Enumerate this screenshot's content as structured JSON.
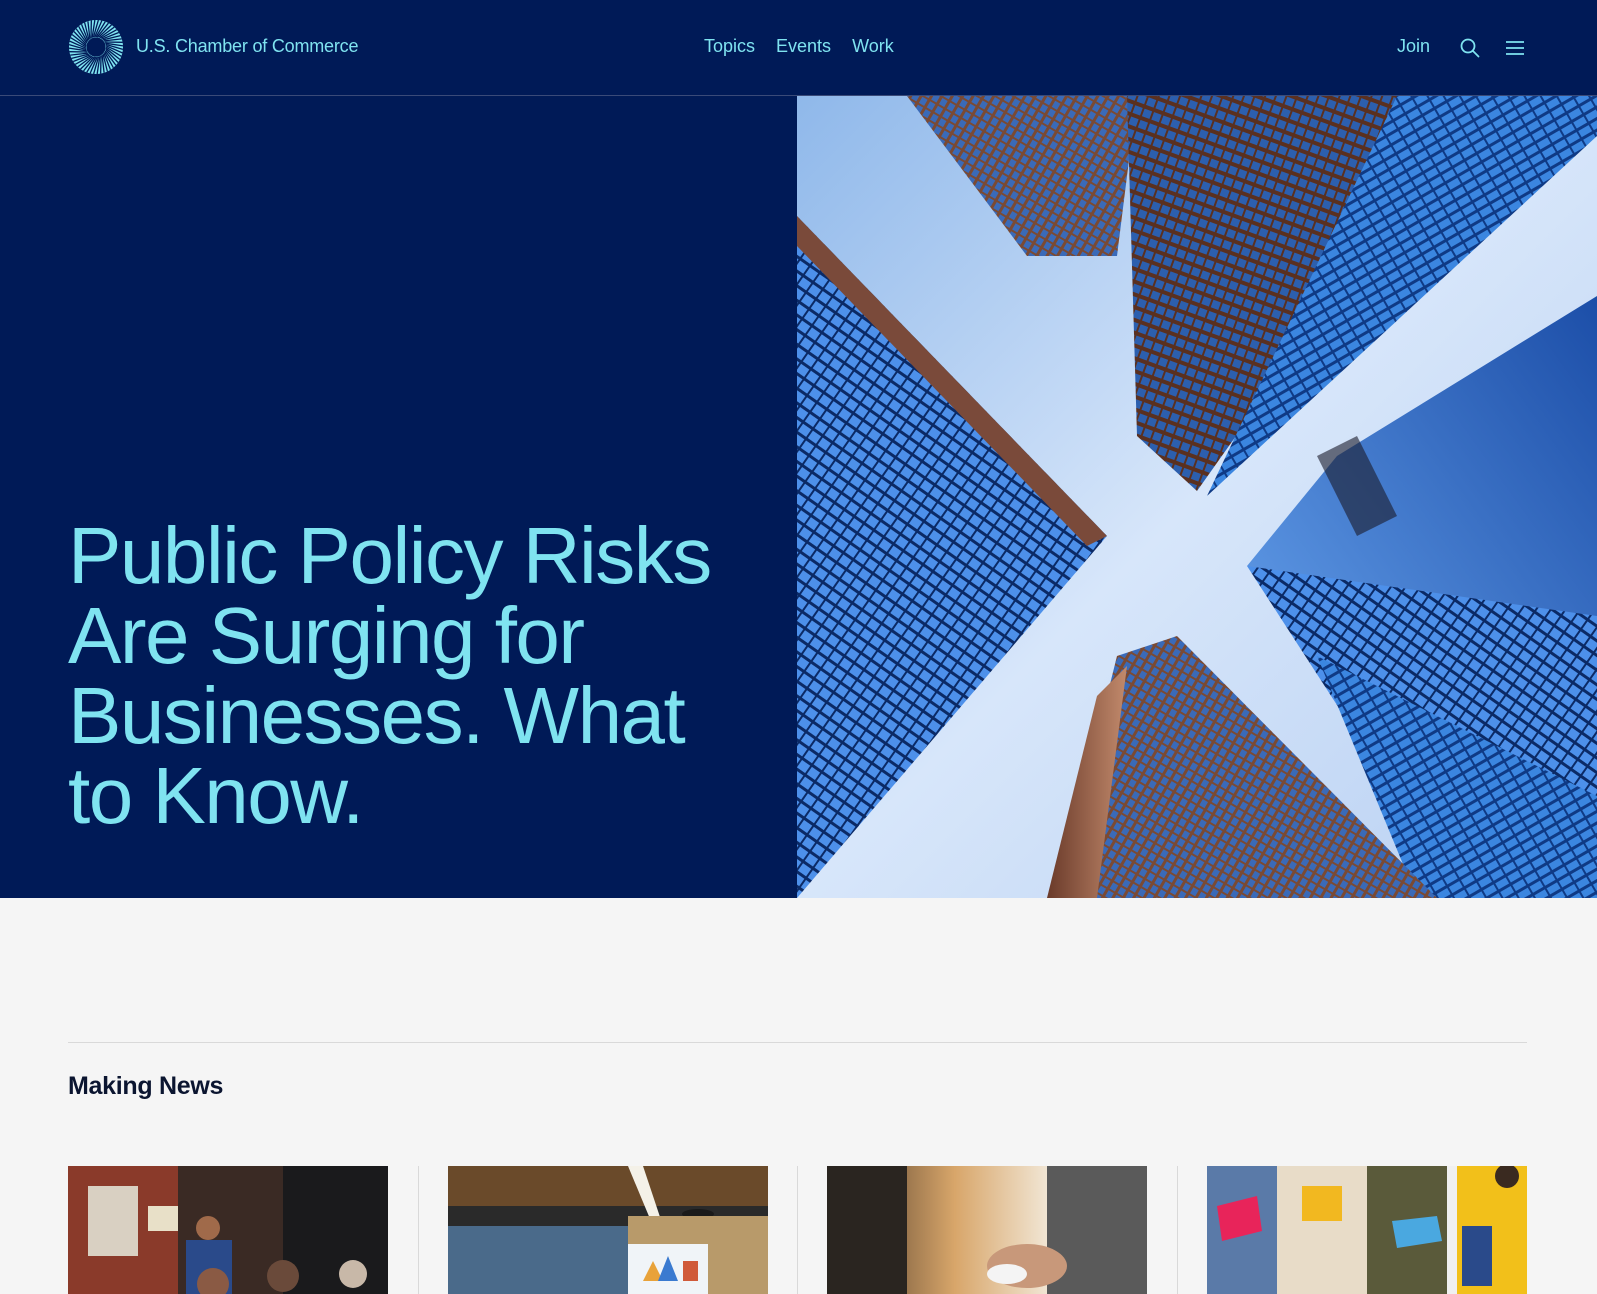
{
  "header": {
    "brand": "U.S. Chamber of Commerce",
    "nav": [
      "Topics",
      "Events",
      "Work"
    ],
    "join_label": "Join",
    "search_icon": "search-icon",
    "menu_icon": "hamburger-menu-icon",
    "logo_icon": "starburst-logo-icon"
  },
  "hero": {
    "title": "Public Policy Risks Are Surging for Businesses. What to Know.",
    "image": "skyscrapers-looking-up-photo"
  },
  "making_news": {
    "title": "Making News",
    "cards": [
      {
        "image": "restaurant-worker-photo"
      },
      {
        "image": "office-meeting-room-photo"
      },
      {
        "image": "business-handshake-photo"
      },
      {
        "image": "students-with-folders-photo"
      }
    ]
  },
  "colors": {
    "navy": "#001a57",
    "accent": "#7fe3f0",
    "background": "#f5f5f5"
  }
}
